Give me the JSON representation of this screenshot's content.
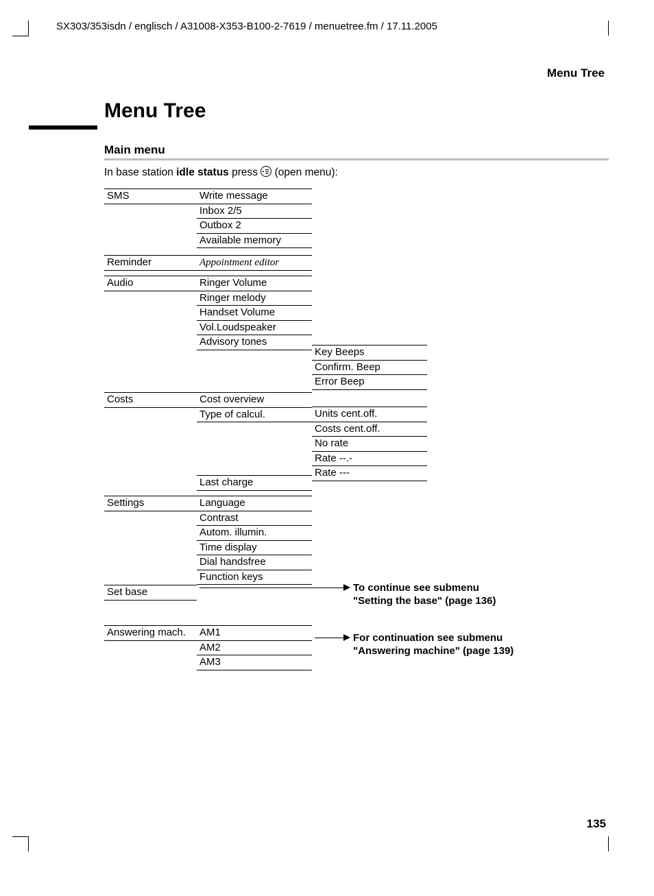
{
  "header": {
    "doc_path": "SX303/353isdn / englisch / A31008-X353-B100-2-7619 / menuetree.fm / 17.11.2005",
    "running_head": "Menu Tree"
  },
  "title": "Menu Tree",
  "section": "Main menu",
  "intro": {
    "prefix": "In base station ",
    "bold": "idle status",
    "mid": " press ",
    "suffix": " (open menu):"
  },
  "menu": {
    "sms": {
      "label": "SMS",
      "items": [
        "Write message",
        "Inbox 2/5",
        "Outbox 2",
        "Available memory"
      ]
    },
    "reminder": {
      "label": "Reminder",
      "items": [
        "Appointment editor"
      ]
    },
    "audio": {
      "label": "Audio",
      "items": [
        "Ringer Volume",
        "Ringer melody",
        "Handset Volume",
        "Vol.Loudspeaker",
        "Advisory tones"
      ],
      "sub_advisory": [
        "Key Beeps",
        "Confirm. Beep",
        "Error Beep"
      ]
    },
    "costs": {
      "label": "Costs",
      "items": [
        "Cost overview",
        "Type of calcul."
      ],
      "sub_calcul": [
        "Units cent.off.",
        "Costs cent.off.",
        "No rate",
        "Rate --.-",
        "Rate ---"
      ],
      "tail": [
        "Last charge"
      ]
    },
    "settings": {
      "label": "Settings",
      "items": [
        "Language",
        "Contrast",
        "Autom. illumin.",
        "Time display",
        "Dial handsfree",
        "Function keys"
      ]
    },
    "setbase": {
      "label": "Set base",
      "note1": "To continue see submenu",
      "note2": "\"Setting the base\" (page 136)"
    },
    "ansmach": {
      "label": "Answering mach.",
      "items": [
        "AM1",
        "AM2",
        "AM3"
      ],
      "note1": "For continuation see submenu",
      "note2": "\"Answering machine\" (page 139)"
    }
  },
  "page_number": "135"
}
